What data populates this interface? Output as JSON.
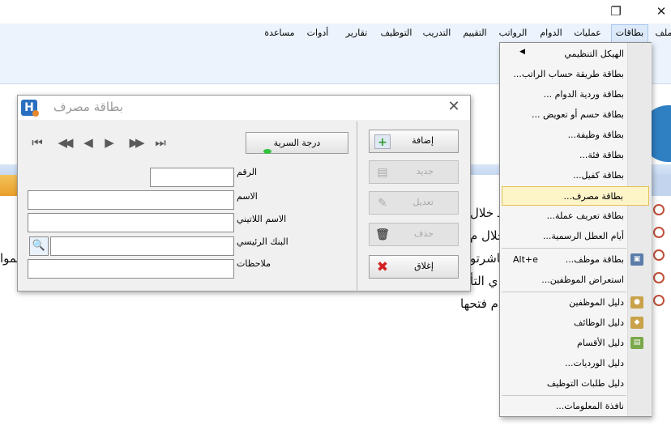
{
  "window": {
    "maximize_glyph": "❐",
    "close_glyph": "✕"
  },
  "menubar": {
    "items": [
      {
        "label": "ملف"
      },
      {
        "label": "بطاقات"
      },
      {
        "label": "عمليات"
      },
      {
        "label": "الدوام"
      },
      {
        "label": "الرواتب"
      },
      {
        "label": "التقييم"
      },
      {
        "label": "التدريب"
      },
      {
        "label": "التوظيف"
      },
      {
        "label": "تقارير"
      },
      {
        "label": "أدوات"
      },
      {
        "label": "مساعدة"
      }
    ]
  },
  "background": {
    "lines": [
      "ـ خلال",
      "خلال م",
      "باشرتو",
      "ي التأ",
      "م فتحها",
      "الموا"
    ]
  },
  "dialog": {
    "title": "بطاقة مصرف",
    "app_icon_letter": "H",
    "close_glyph": "✕",
    "nav": {
      "first": "⏮",
      "prev_page": "◀◀",
      "prev": "◀",
      "next": "▶",
      "next_page": "▶▶",
      "last": "⏭"
    },
    "secret_button": "درجة السرية",
    "fields": {
      "number": {
        "label": "الرقم",
        "value": ""
      },
      "name": {
        "label": "الاسم",
        "value": ""
      },
      "latin_name": {
        "label": "الاسم اللاتيني",
        "value": ""
      },
      "main_bank": {
        "label": "البنك الرئيسي",
        "value": ""
      },
      "notes": {
        "label": "ملاحظات",
        "value": ""
      }
    },
    "actions": {
      "add": "إضافة",
      "new": "جديد",
      "edit": "تعديل",
      "delete": "حذف",
      "close": "إغلاق"
    }
  },
  "dropdown": {
    "items": [
      {
        "label": "الهيكل التنظيمي",
        "submenu": "◀"
      },
      {
        "label": "بطاقة طريقة حساب الراتب..."
      },
      {
        "label": "بطاقة وردية الدوام ..."
      },
      {
        "label": "بطاقة حسم أو تعويض ..."
      },
      {
        "label": "بطاقة وظيفة..."
      },
      {
        "label": "بطاقة فئة..."
      },
      {
        "label": "بطاقة كفيل..."
      },
      {
        "label": "بطاقة مصرف..."
      },
      {
        "label": "بطاقة تعريف عملة..."
      },
      {
        "label": "أيام العطل الرسمية..."
      },
      {
        "label": "بطاقة موظف...",
        "shortcut": "Alt+e"
      },
      {
        "label": "استعراض الموظفين..."
      },
      {
        "label": "دليل الموظفين"
      },
      {
        "label": "دليل الوظائف"
      },
      {
        "label": "دليل الأقسام"
      },
      {
        "label": "دليل الورديات..."
      },
      {
        "label": "دليل طلبات التوظيف"
      },
      {
        "label": "نافذة المعلومات..."
      }
    ]
  },
  "colors": {
    "accent": "#2a6fbf",
    "highlight": "#fdf4c8",
    "menubar": "#ecf3fc"
  }
}
